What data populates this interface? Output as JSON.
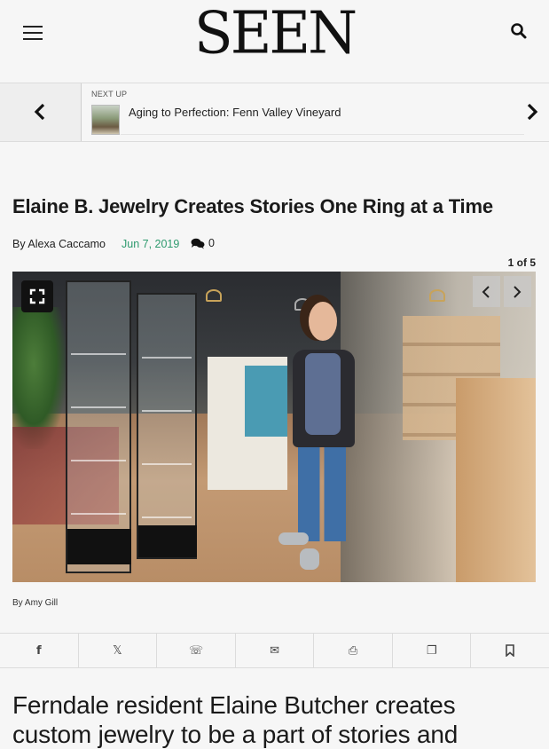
{
  "header": {
    "logo": "SEEN",
    "menu_icon": "hamburger-menu-icon",
    "search_icon": "search-icon"
  },
  "next_up": {
    "label": "NEXT UP",
    "title": "Aging to Perfection: Fenn Valley Vineyard",
    "prev_icon": "chevron-left-icon",
    "next_icon": "chevron-right-icon"
  },
  "article": {
    "headline": "Elaine B. Jewelry Creates Stories One Ring at a Time",
    "byline_prefix": "By",
    "author": "Alexa Caccamo",
    "date": "Jun 7, 2019",
    "comment_count": "0",
    "date_color": "#2e9a6e"
  },
  "gallery": {
    "counter": "1 of 5",
    "credit": "By Amy Gill",
    "fullscreen_icon": "fullscreen-icon"
  },
  "share": {
    "items": [
      {
        "name": "facebook",
        "glyph": "f"
      },
      {
        "name": "x-twitter",
        "glyph": "𝕏"
      },
      {
        "name": "whatsapp",
        "glyph": "☏"
      },
      {
        "name": "email",
        "glyph": "✉"
      },
      {
        "name": "print",
        "glyph": "⎙"
      },
      {
        "name": "copy",
        "glyph": "❐"
      },
      {
        "name": "bookmark",
        "glyph": "🔖"
      }
    ]
  },
  "lead_text": "Ferndale resident Elaine Butcher creates custom jewelry to be a part of stories and"
}
